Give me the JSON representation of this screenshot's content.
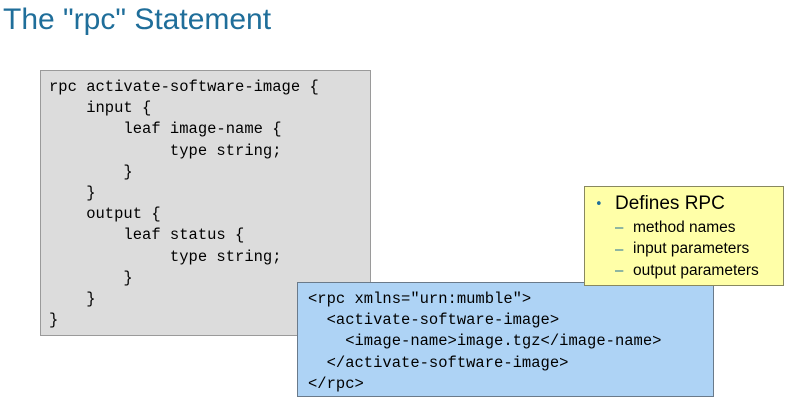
{
  "slide": {
    "title": "The \"rpc\" Statement"
  },
  "yang_code": {
    "lines": [
      "rpc activate-software-image {",
      "    input {",
      "        leaf image-name {",
      "             type string;",
      "        }",
      "    }",
      "    output {",
      "        leaf status {",
      "             type string;",
      "        }",
      "    }",
      "}"
    ]
  },
  "xml_example": {
    "lines": [
      "<rpc xmlns=\"urn:mumble\">",
      "  <activate-software-image>",
      "    <image-name>image.tgz</image-name>",
      "  </activate-software-image>",
      "</rpc>"
    ]
  },
  "callout": {
    "bullet": "•",
    "title": "Defines RPC",
    "dash": "–",
    "items": [
      "method names",
      "input parameters",
      "output parameters"
    ]
  }
}
